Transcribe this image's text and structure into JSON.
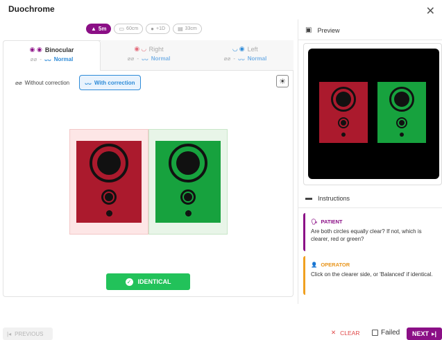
{
  "title": "Duochrome",
  "distance_chips": [
    {
      "label": "5m",
      "icon": "mountain-icon",
      "active": true
    },
    {
      "label": "60cm",
      "icon": "monitor-icon",
      "active": false
    },
    {
      "label": "+1D",
      "icon": "lens-icon",
      "active": false
    },
    {
      "label": "33cm",
      "icon": "book-icon",
      "active": false
    }
  ],
  "eye_tabs": [
    {
      "label": "Binocular",
      "without": "-",
      "with": "Normal"
    },
    {
      "label": "Right",
      "without": "-",
      "with": "Normal"
    },
    {
      "label": "Left",
      "without": "-",
      "with": "Normal"
    }
  ],
  "correction": {
    "without_label": "Without correction",
    "with_label": "With correction"
  },
  "identical_label": "IDENTICAL",
  "preview": {
    "title": "Preview"
  },
  "instructions": {
    "title": "Instructions",
    "patient": {
      "role": "PATIENT",
      "text": "Are both circles equally clear? If not, which is clearer, red or green?"
    },
    "operator": {
      "role": "OPERATOR",
      "text": "Click on the clearer side, or 'Balanced' if identical."
    }
  },
  "footer": {
    "previous": "PREVIOUS",
    "clear": "CLEAR",
    "failed": "Failed",
    "next": "NEXT"
  },
  "colors": {
    "accent": "#8b0f86",
    "red_panel": "#ab1a2d",
    "green_panel": "#17a23e",
    "with_correction": "#2e8bd8",
    "identical": "#22c25a"
  }
}
